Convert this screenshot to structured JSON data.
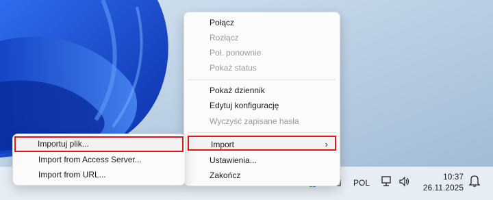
{
  "main_menu": {
    "items": [
      {
        "label": "Połącz",
        "enabled": true
      },
      {
        "label": "Rozłącz",
        "enabled": false
      },
      {
        "label": "Poł. ponownie",
        "enabled": false
      },
      {
        "label": "Pokaż status",
        "enabled": false
      },
      {
        "label": "Pokaż dziennik",
        "enabled": true
      },
      {
        "label": "Edytuj konfigurację",
        "enabled": true
      },
      {
        "label": "Wyczyść zapisane hasła",
        "enabled": false
      },
      {
        "label": "Import",
        "enabled": true,
        "submenu": true
      },
      {
        "label": "Ustawienia...",
        "enabled": true
      },
      {
        "label": "Zakończ",
        "enabled": true
      }
    ]
  },
  "submenu": {
    "items": [
      {
        "label": "Importuj plik..."
      },
      {
        "label": "Import from Access Server..."
      },
      {
        "label": "Import from URL..."
      }
    ]
  },
  "taskbar": {
    "language": "POL",
    "time": "10:37",
    "date": "26.11.2025"
  },
  "colors": {
    "highlight_border": "#e0161b",
    "wallpaper_blue": "#1f4fd6"
  },
  "icons": [
    "submenu-chevron-icon",
    "network-icon",
    "volume-icon",
    "notification-icon",
    "tray-app-icon"
  ]
}
